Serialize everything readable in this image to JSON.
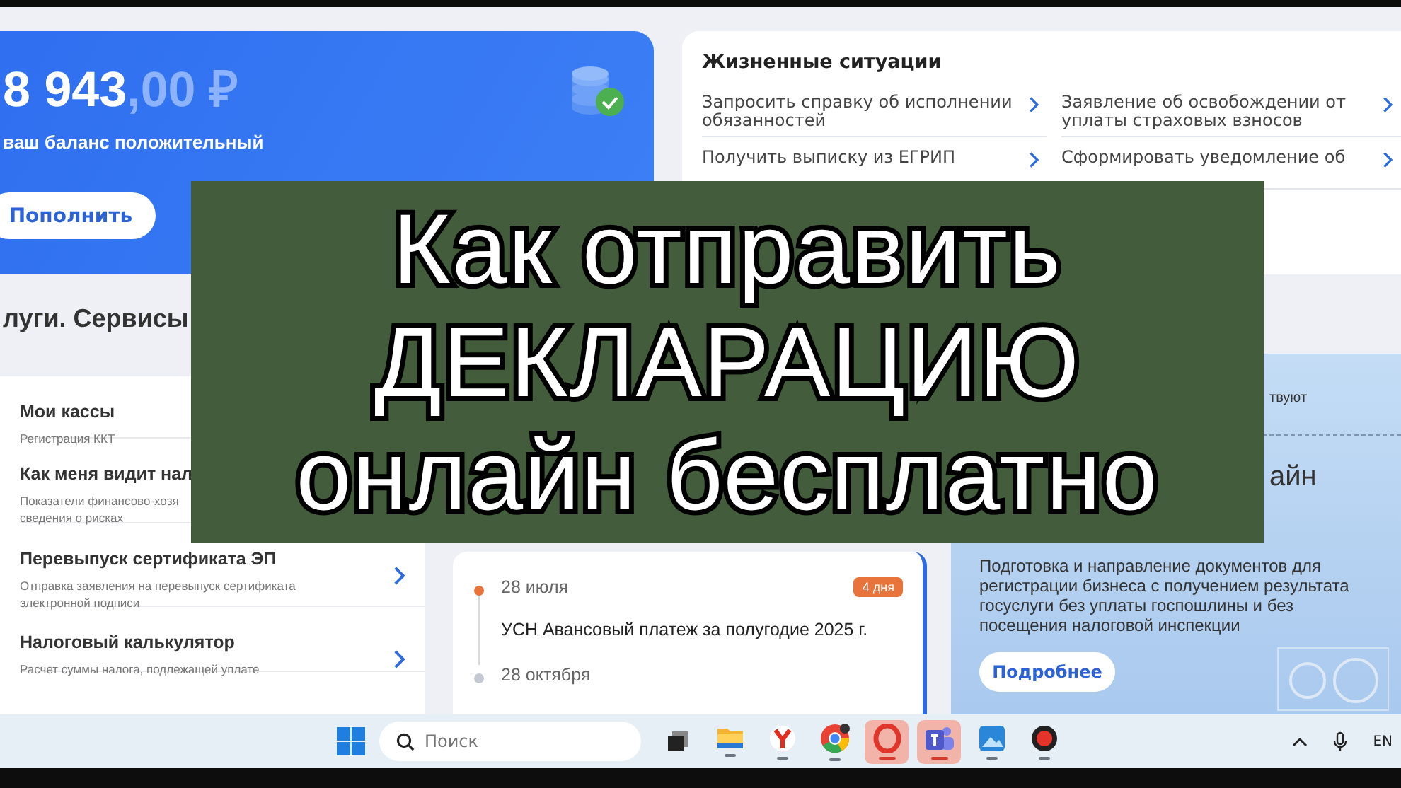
{
  "balance": {
    "amount": "8 943",
    "fraction": ",00 ₽",
    "caption": "ваш баланс положительный",
    "button": "Пополнить"
  },
  "life_situations": {
    "title": "Жизненные ситуации",
    "links": [
      {
        "text": "Запросить справку об исполнении обязанностей"
      },
      {
        "text": "Заявление об освобождении от уплаты страховых взносов"
      },
      {
        "text": "Получить выписку из ЕГРИП"
      },
      {
        "text": "Сформировать уведомление об"
      }
    ]
  },
  "services": {
    "title": "луги. Сервисы",
    "items": [
      {
        "title": "Мои кассы",
        "subtitle": "Регистрация ККТ"
      },
      {
        "title": "Как меня видит нал",
        "subtitle": "Показатели финансово-хозя",
        "subtitle_2": "сведения о рисках"
      },
      {
        "title": "Перевыпуск сертификата ЭП",
        "subtitle": "Отправка заявления на перевыпуск сертификата",
        "subtitle_2": "электронной подписи"
      },
      {
        "title": "Налоговый калькулятор",
        "subtitle": "Расчет суммы налога, подлежащей уплате"
      }
    ]
  },
  "calendar": {
    "events": [
      {
        "date": "28 июля",
        "badge": "4 дня",
        "title": "УСН Авансовый платеж за полугодие 2025 г.",
        "color": "#e8743b"
      },
      {
        "date": "28 октября",
        "color": "#c4c9d2"
      }
    ]
  },
  "promo": {
    "top_text": "твуют",
    "heading": "айн",
    "body": "Подготовка и направление документов для регистрации бизнеса с получением результата госуслуги без уплаты госпошлины и без посещения налоговой инспекции",
    "button": "Подробнее"
  },
  "overlay": {
    "lines": [
      "Как отправить",
      "ДЕКЛАРАЦИЮ",
      "онлайн бесплатно"
    ]
  },
  "taskbar": {
    "search": {
      "placeholder": "Поиск"
    },
    "apps": [
      {
        "kind": "taskview",
        "running": false,
        "highlighted": false
      },
      {
        "kind": "folder",
        "running": true,
        "highlighted": false
      },
      {
        "kind": "browser",
        "running": true,
        "highlighted": false
      },
      {
        "kind": "chrome",
        "running": true,
        "highlighted": false
      },
      {
        "kind": "opera",
        "running": true,
        "highlighted": true
      },
      {
        "kind": "teams",
        "running": true,
        "highlighted": true
      },
      {
        "kind": "photos",
        "running": true,
        "highlighted": false
      },
      {
        "kind": "record",
        "running": true,
        "highlighted": false
      }
    ],
    "language": "EN"
  }
}
